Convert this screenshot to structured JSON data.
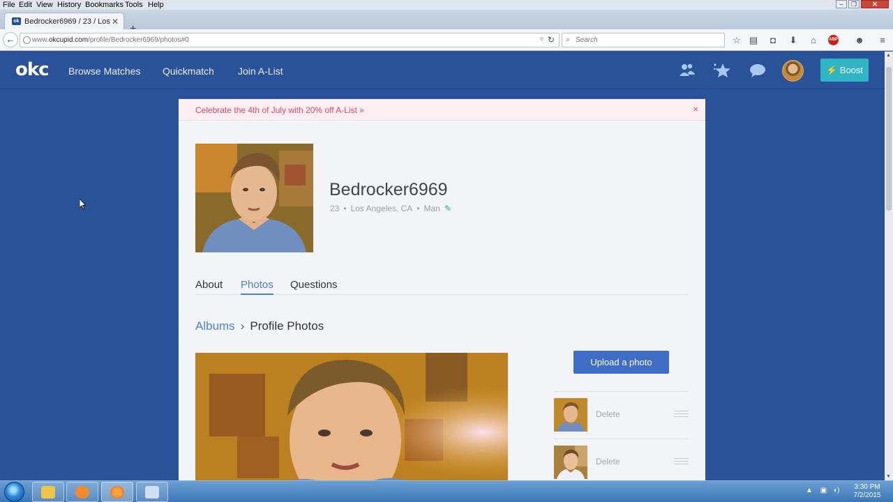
{
  "menubar": {
    "items": [
      "File",
      "Edit",
      "View",
      "History",
      "Bookmarks",
      "Tools",
      "Help"
    ]
  },
  "browser": {
    "tab_title": "Bedrocker6969 / 23 / Los A...",
    "tab_favicon": "ok",
    "url_prefix": "www.",
    "url_domain": "okcupid.com",
    "url_path": "/profile/Bedrocker6969/photos#0",
    "search_placeholder": "Search",
    "abp_label": "ABP"
  },
  "site": {
    "logo": "okc",
    "nav": [
      "Browse Matches",
      "Quickmatch",
      "Join A-List"
    ],
    "boost_label": "Boost"
  },
  "promo": {
    "text": "Celebrate the 4th of July with 20% off A-List »",
    "close": "×"
  },
  "profile": {
    "username": "Bedrocker6969",
    "age": "23",
    "location": "Los Angeles, CA",
    "gender": "Man"
  },
  "tabs": [
    {
      "label": "About",
      "active": false
    },
    {
      "label": "Photos",
      "active": true
    },
    {
      "label": "Questions",
      "active": false
    }
  ],
  "breadcrumb": {
    "link": "Albums",
    "separator": "›",
    "current": "Profile Photos"
  },
  "photos": {
    "upload_label": "Upload a photo",
    "items": [
      {
        "delete_label": "Delete"
      },
      {
        "delete_label": "Delete"
      }
    ]
  },
  "taskbar": {
    "time": "3:30 PM",
    "date": "7/2/2015"
  },
  "colors": {
    "site_blue": "#2a5298",
    "link_blue": "#4b7fcc",
    "boost": "#30b5c4",
    "promo_pink": "#e0446e",
    "edit_green": "#27b36b"
  }
}
